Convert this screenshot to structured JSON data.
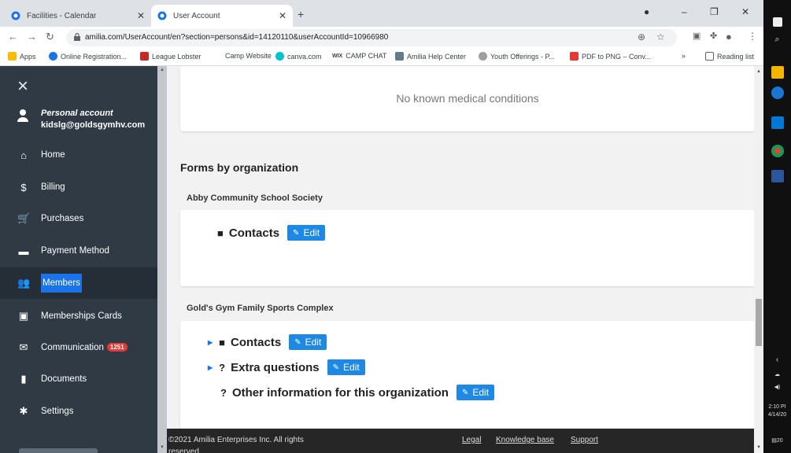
{
  "browser": {
    "tabs": [
      {
        "label": "Facilities - Calendar"
      },
      {
        "label": "User Account"
      }
    ],
    "url": "amilia.com/UserAccount/en?section=persons&id=14120110&userAccountId=10966980",
    "bookmarks": [
      {
        "label": "Apps",
        "color": "#fbbc04"
      },
      {
        "label": "Online Registration...",
        "color": "#1a73e8"
      },
      {
        "label": "League Lobster",
        "color": "#c62828"
      },
      {
        "label": "Camp Website",
        "color": ""
      },
      {
        "label": "canva.com",
        "color": "#00c4cc"
      },
      {
        "label": "CAMP CHAT",
        "color": ""
      },
      {
        "label": "Amilia Help Center",
        "color": "#607d8b"
      },
      {
        "label": "Youth Offerings - P...",
        "color": "#9e9e9e"
      },
      {
        "label": "PDF to PNG – Conv...",
        "color": "#e53935"
      }
    ],
    "bookmarks_more": "»",
    "reading_list": "Reading list"
  },
  "sidebar": {
    "account_type": "Personal account",
    "account_email": "kidslg@goldsgymhv.com",
    "items": [
      {
        "label": "Home",
        "icon": "home-icon",
        "glyph": "⌂"
      },
      {
        "label": "Billing",
        "icon": "dollar-icon",
        "glyph": "$"
      },
      {
        "label": "Purchases",
        "icon": "cart-icon",
        "glyph": "🛒"
      },
      {
        "label": "Payment Method",
        "icon": "credit-card-icon",
        "glyph": "▬"
      },
      {
        "label": "Members",
        "icon": "users-icon",
        "glyph": "👥"
      },
      {
        "label": "Memberships Cards",
        "icon": "id-card-icon",
        "glyph": "▣"
      },
      {
        "label": "Communication",
        "icon": "envelope-icon",
        "glyph": "✉",
        "badge": "1251"
      },
      {
        "label": "Documents",
        "icon": "document-icon",
        "glyph": "▮"
      },
      {
        "label": "Settings",
        "icon": "gear-icon",
        "glyph": "✱"
      }
    ],
    "active_item": "Members"
  },
  "main": {
    "medical": "No known medical conditions",
    "section_title": "Forms by organization",
    "orgs": [
      {
        "name": "Abby Community School Society",
        "forms": [
          {
            "label": "Contacts",
            "icon": "book-icon",
            "glyph": "📕",
            "edit": "Edit"
          }
        ]
      },
      {
        "name": "Gold's Gym Family Sports Complex",
        "forms": [
          {
            "label": "Contacts",
            "icon": "book-icon",
            "glyph": "📕",
            "edit": "Edit"
          },
          {
            "label": "Extra questions",
            "icon": "question-icon",
            "glyph": "?",
            "edit": "Edit"
          },
          {
            "label": "Other information for this organization",
            "icon": "question-icon",
            "glyph": "?",
            "edit": "Edit"
          }
        ]
      }
    ]
  },
  "footer": {
    "copyright_line1": "©2021 Amilia Enterprises Inc. All rights",
    "copyright_line2": "reserved",
    "links": [
      "Legal",
      "Knowledge base",
      "Support"
    ]
  },
  "taskbar": {
    "time": "2:10 PI",
    "date": "4/14/20",
    "notif": "20"
  }
}
